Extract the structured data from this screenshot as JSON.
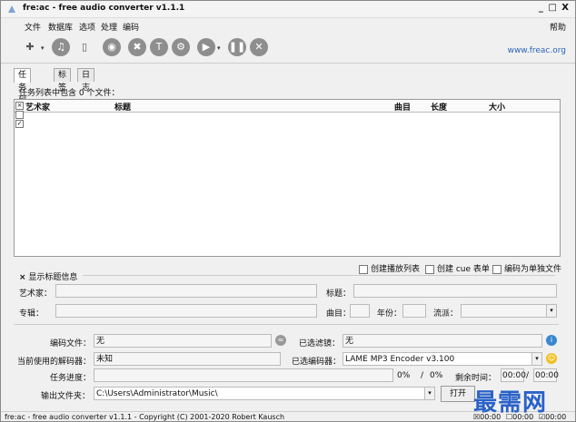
{
  "window": {
    "title": "fre:ac - free audio converter v1.1.1",
    "controls": "_ □ X"
  },
  "menu": {
    "items": [
      "文件",
      "数据库",
      "选项",
      "处理",
      "编码"
    ],
    "help": "帮助"
  },
  "toolbar": {
    "url": "www.freac.org"
  },
  "tabs": [
    "任务列表",
    "标签",
    "日志"
  ],
  "joblist": {
    "count_text": "任务列表中包含 0 个文件：",
    "columns": {
      "artist": "艺术家",
      "title": "标题",
      "track": "曲目",
      "length": "长度",
      "size": "大小"
    }
  },
  "options": {
    "playlist": "创建播放列表",
    "cue": "创建 cue 表单",
    "single": "编码为单独文件"
  },
  "tag_panel": {
    "toggle": "显示标题信息",
    "artist": "艺术家：",
    "title": "标题：",
    "album": "专辑：",
    "track": "曲目：",
    "year": "年份：",
    "genre": "流派："
  },
  "status_panel": {
    "encoding_file_label": "编码文件：",
    "encoding_file_value": "无",
    "filter_label": "已选滤镜：",
    "filter_value": "无",
    "decoder_label": "当前使用的解码器：",
    "decoder_value": "未知",
    "encoder_label": "已选编码器：",
    "encoder_value": "LAME MP3 Encoder v3.100",
    "progress_label": "任务进度：",
    "progress_file_pct": "0%",
    "slash": "/",
    "progress_total_pct": "0%",
    "remaining_label": "剩余时间：",
    "remaining_1": "00:00",
    "remaining_2": "00:00",
    "output_label": "输出文件夹：",
    "output_value": "C:\\Users\\Administrator\\Music\\",
    "open_button": "打开"
  },
  "statusbar": {
    "text": "fre:ac - free audio converter v1.1.1 - Copyright (C) 2001-2020 Robert Kausch",
    "t1": "00:00",
    "t2": "00:00",
    "t3": "00:00"
  },
  "watermark": "最需网"
}
